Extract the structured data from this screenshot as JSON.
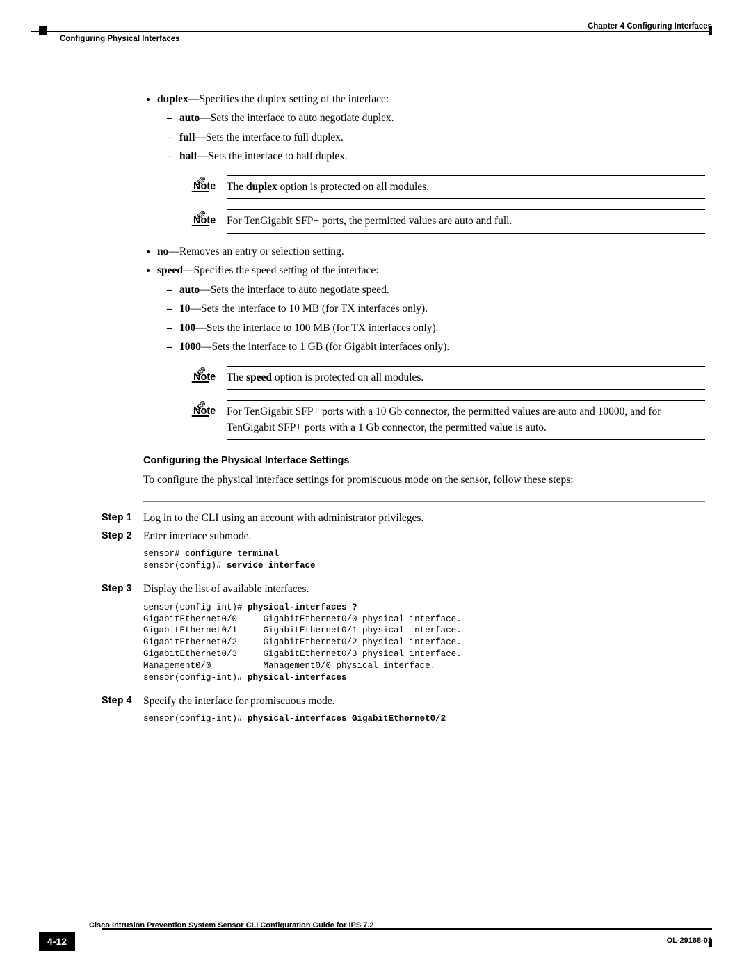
{
  "header": {
    "chapter": "Chapter 4      Configuring Interfaces",
    "section": "Configuring Physical Interfaces"
  },
  "bullets": {
    "duplex": {
      "lead": "duplex",
      "tail": "—Specifies the duplex setting of the interface:",
      "subs": [
        {
          "lead": "auto",
          "tail": "—Sets the interface to auto negotiate duplex."
        },
        {
          "lead": "full",
          "tail": "—Sets the interface to full duplex."
        },
        {
          "lead": "half",
          "tail": "—Sets the interface to half duplex."
        }
      ]
    },
    "no": {
      "lead": "no",
      "tail": "—Removes an entry or selection setting."
    },
    "speed": {
      "lead": "speed",
      "tail": "—Specifies the speed setting of the interface:",
      "subs": [
        {
          "lead": "auto",
          "tail": "—Sets the interface to auto negotiate speed."
        },
        {
          "lead": "10",
          "tail": "—Sets the interface to 10 MB (for TX interfaces only)."
        },
        {
          "lead": "100",
          "tail": "—Sets the interface to 100 MB (for TX interfaces only)."
        },
        {
          "lead": "1000",
          "tail": "—Sets the interface to 1 GB (for Gigabit interfaces only)."
        }
      ]
    }
  },
  "notes": {
    "label": "Note",
    "n1a": "The ",
    "n1b": "duplex",
    "n1c": " option is protected on all modules.",
    "n2": "For TenGigabit SFP+ ports, the permitted values are auto and full.",
    "n3a": "The ",
    "n3b": "speed",
    "n3c": " option is protected on all modules.",
    "n4": "For TenGigabit SFP+ ports with a 10 Gb connector, the permitted values are auto and 10000, and for TenGigabit SFP+ ports with a 1 Gb connector, the permitted value is auto."
  },
  "section": {
    "heading": "Configuring the Physical Interface Settings",
    "intro": "To configure the physical interface settings for promiscuous mode on the sensor, follow these steps:"
  },
  "steps": {
    "s1": {
      "label": "Step 1",
      "text": "Log in to the CLI using an account with administrator privileges."
    },
    "s2": {
      "label": "Step 2",
      "text": "Enter interface submode.",
      "code_line1_prefix": "sensor# ",
      "code_line1_cmd": "configure terminal",
      "code_line2_prefix": "sensor(config)# ",
      "code_line2_cmd": "service interface"
    },
    "s3": {
      "label": "Step 3",
      "text": "Display the list of available interfaces.",
      "code_line1_prefix": "sensor(config-int)# ",
      "code_line1_cmd": "physical-interfaces ?",
      "code_body": "GigabitEthernet0/0     GigabitEthernet0/0 physical interface.\nGigabitEthernet0/1     GigabitEthernet0/1 physical interface.\nGigabitEthernet0/2     GigabitEthernet0/2 physical interface.\nGigabitEthernet0/3     GigabitEthernet0/3 physical interface.\nManagement0/0          Management0/0 physical interface.",
      "code_line2_prefix": "sensor(config-int)# ",
      "code_line2_cmd": "physical-interfaces"
    },
    "s4": {
      "label": "Step 4",
      "text": "Specify the interface for promiscuous mode.",
      "code_line1_prefix": "sensor(config-int)# ",
      "code_line1_cmd": "physical-interfaces GigabitEthernet0/2"
    }
  },
  "footer": {
    "guide": "Cisco Intrusion Prevention System Sensor CLI Configuration Guide for IPS 7.2",
    "pagenum": "4-12",
    "docnum": "OL-29168-01"
  }
}
